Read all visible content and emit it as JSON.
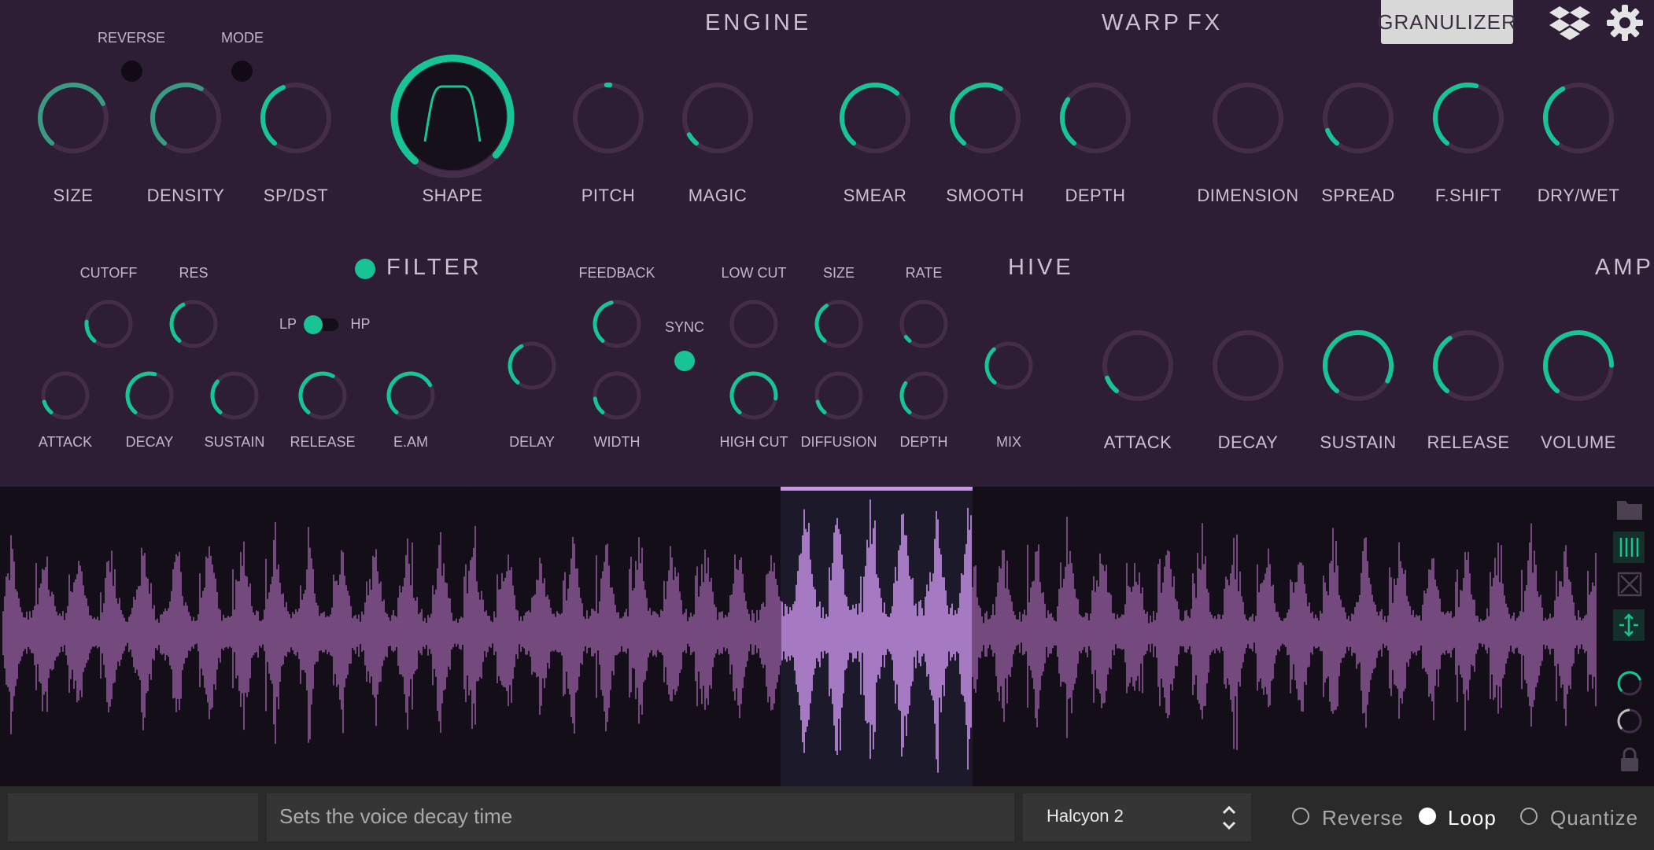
{
  "engine": {
    "title": "ENGINE",
    "toggles": [
      {
        "label": "REVERSE",
        "on": false
      },
      {
        "label": "MODE",
        "on": false
      }
    ],
    "knobs": [
      {
        "label": "SIZE",
        "value": 0.73
      },
      {
        "label": "DENSITY",
        "value": 0.6
      },
      {
        "label": "SP/DST",
        "value": 0.42
      },
      {
        "label": "SHAPE",
        "value": 0.97
      },
      {
        "label": "PITCH",
        "value": 0.5
      },
      {
        "label": "MAGIC",
        "value": 0.07
      }
    ]
  },
  "warp": {
    "title": "WARP",
    "knobs": [
      {
        "label": "SMEAR",
        "value": 0.65
      },
      {
        "label": "SMOOTH",
        "value": 0.6
      },
      {
        "label": "DEPTH",
        "value": 0.3
      }
    ]
  },
  "fx": {
    "title": "FX",
    "mode_button": "GRANULIZER",
    "knobs": [
      {
        "label": "DIMENSION",
        "value": 0.0
      },
      {
        "label": "SPREAD",
        "value": 0.1
      },
      {
        "label": "F.SHIFT",
        "value": 0.55
      },
      {
        "label": "DRY/WET",
        "value": 0.4
      }
    ]
  },
  "filter": {
    "title": "FILTER",
    "enabled": true,
    "top_knobs": [
      {
        "label": "CUTOFF",
        "value": 0.2
      },
      {
        "label": "RES",
        "value": 0.4
      }
    ],
    "switch": {
      "left": "LP",
      "right": "HP",
      "state": "LP"
    },
    "knobs": [
      {
        "label": "ATTACK",
        "value": 0.12
      },
      {
        "label": "DECAY",
        "value": 0.55
      },
      {
        "label": "SUSTAIN",
        "value": 0.32
      },
      {
        "label": "RELEASE",
        "value": 0.6
      },
      {
        "label": "E.AM",
        "value": 0.72
      }
    ]
  },
  "hive": {
    "title": "HIVE",
    "sync": {
      "label": "SYNC",
      "on": true
    },
    "top_knobs": [
      {
        "label": "FEEDBACK",
        "value": 0.45
      },
      {
        "label": "LOW CUT",
        "value": 0.0
      },
      {
        "label": "SIZE",
        "value": 0.38
      },
      {
        "label": "RATE",
        "value": 0.05
      }
    ],
    "bottom_knobs": [
      {
        "label": "WIDTH",
        "value": 0.15
      },
      {
        "label": "HIGH CUT",
        "value": 0.85
      },
      {
        "label": "DIFFUSION",
        "value": 0.12
      },
      {
        "label": "DEPTH",
        "value": 0.3
      }
    ],
    "delay": {
      "label": "DELAY",
      "value": 0.4
    },
    "mix": {
      "label": "MIX",
      "value": 0.35
    }
  },
  "amp": {
    "title": "AMP",
    "knobs": [
      {
        "label": "ATTACK",
        "value": 0.1
      },
      {
        "label": "DECAY",
        "value": 0.0
      },
      {
        "label": "SUSTAIN",
        "value": 0.92
      },
      {
        "label": "RELEASE",
        "value": 0.38
      },
      {
        "label": "VOLUME",
        "value": 0.82
      }
    ]
  },
  "waveform": {
    "selection_start": 0.472,
    "selection_end": 0.588
  },
  "bottom": {
    "status": "Sets the voice decay time",
    "preset": "Halcyon 2",
    "options": [
      {
        "label": "Reverse",
        "checked": false
      },
      {
        "label": "Loop",
        "checked": true
      },
      {
        "label": "Quantize",
        "checked": false
      }
    ]
  },
  "colors": {
    "accent": "#18c395",
    "accent_dim": "#3a9b82",
    "track": "#442d48",
    "wave": "#8d5a98",
    "wave_selected": "#c893e8"
  }
}
